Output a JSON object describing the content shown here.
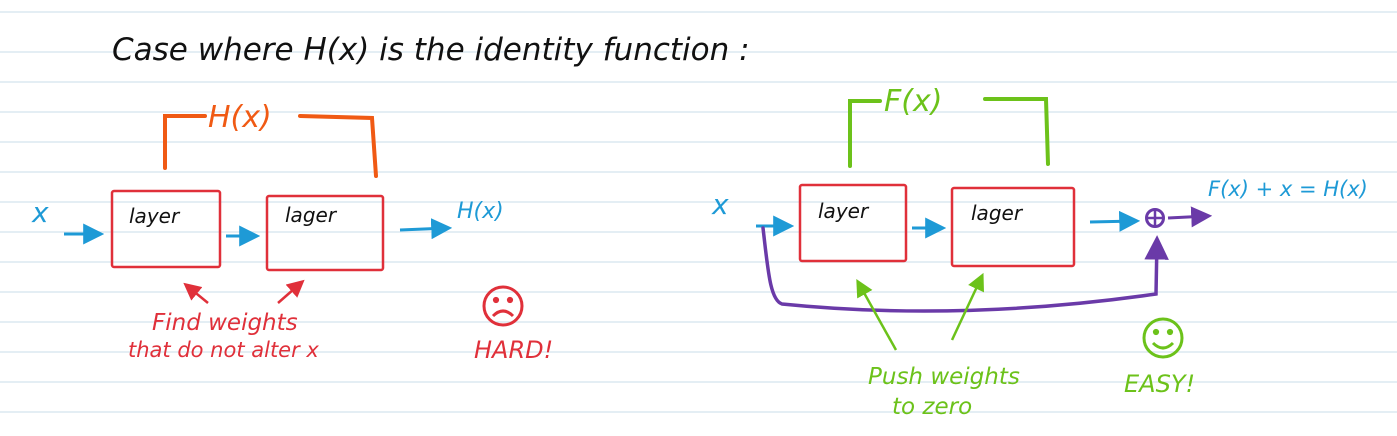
{
  "title": "Case where H(x) is the identity function :",
  "colors": {
    "ink": "#111111",
    "cyan": "#1e9ad6",
    "red": "#e0303a",
    "orange": "#f05a14",
    "green": "#6cc21a",
    "purple": "#6a3aa8",
    "ruled_line": "#dbe9f1"
  },
  "left": {
    "bracket_label": "H(x)",
    "input_label": "x",
    "layer1_label": "layer",
    "layer2_label": "lager",
    "output_label": "H(x)",
    "note_line1": "Find weights",
    "note_line2": "that do not alter x",
    "verdict": "HARD!",
    "face_icon": "sad-face-icon"
  },
  "right": {
    "bracket_label": "F(x)",
    "input_label": "x",
    "layer1_label": "layer",
    "layer2_label": "lager",
    "sum_icon": "plus-circle-icon",
    "output_label": "F(x) + x = H(x)",
    "note_line1": "Push weights",
    "note_line2": "to zero",
    "verdict": "EASY!",
    "face_icon": "happy-face-icon"
  }
}
